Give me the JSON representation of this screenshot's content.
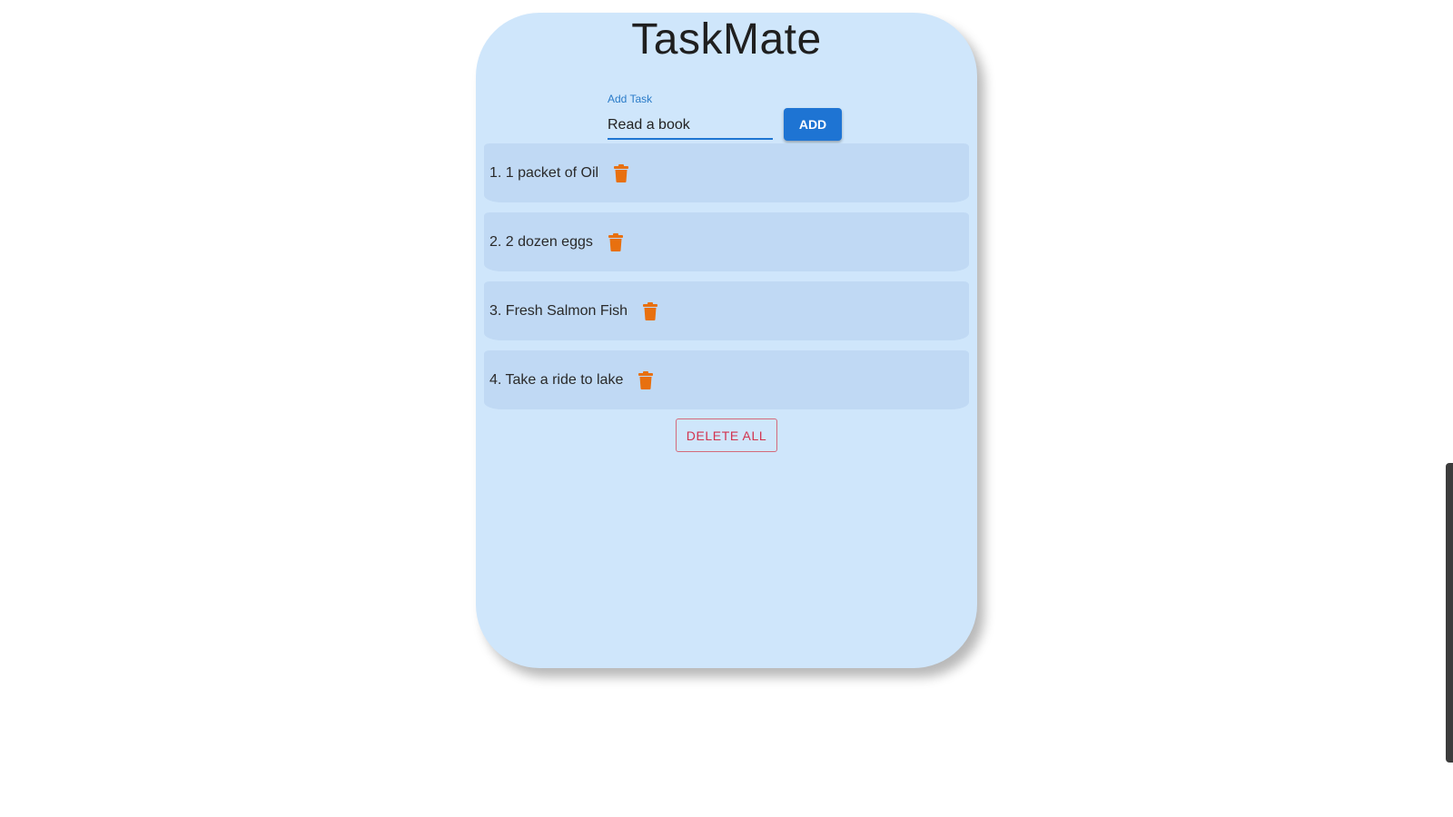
{
  "app": {
    "title": "TaskMate"
  },
  "form": {
    "label": "Add Task",
    "input_value": "Read a book",
    "add_label": "ADD"
  },
  "tasks": [
    {
      "label": "1. 1 packet of Oil"
    },
    {
      "label": "2. 2 dozen eggs"
    },
    {
      "label": "3. Fresh Salmon Fish"
    },
    {
      "label": "4. Take a ride to lake"
    }
  ],
  "actions": {
    "delete_all_label": "DELETE ALL"
  },
  "icons": {
    "delete": "trash-icon"
  },
  "colors": {
    "card_background": "#cfe6fb",
    "task_background": "#c0d9f4",
    "primary": "#1e74d3",
    "danger": "#d2334e",
    "trash": "#e8700f"
  }
}
